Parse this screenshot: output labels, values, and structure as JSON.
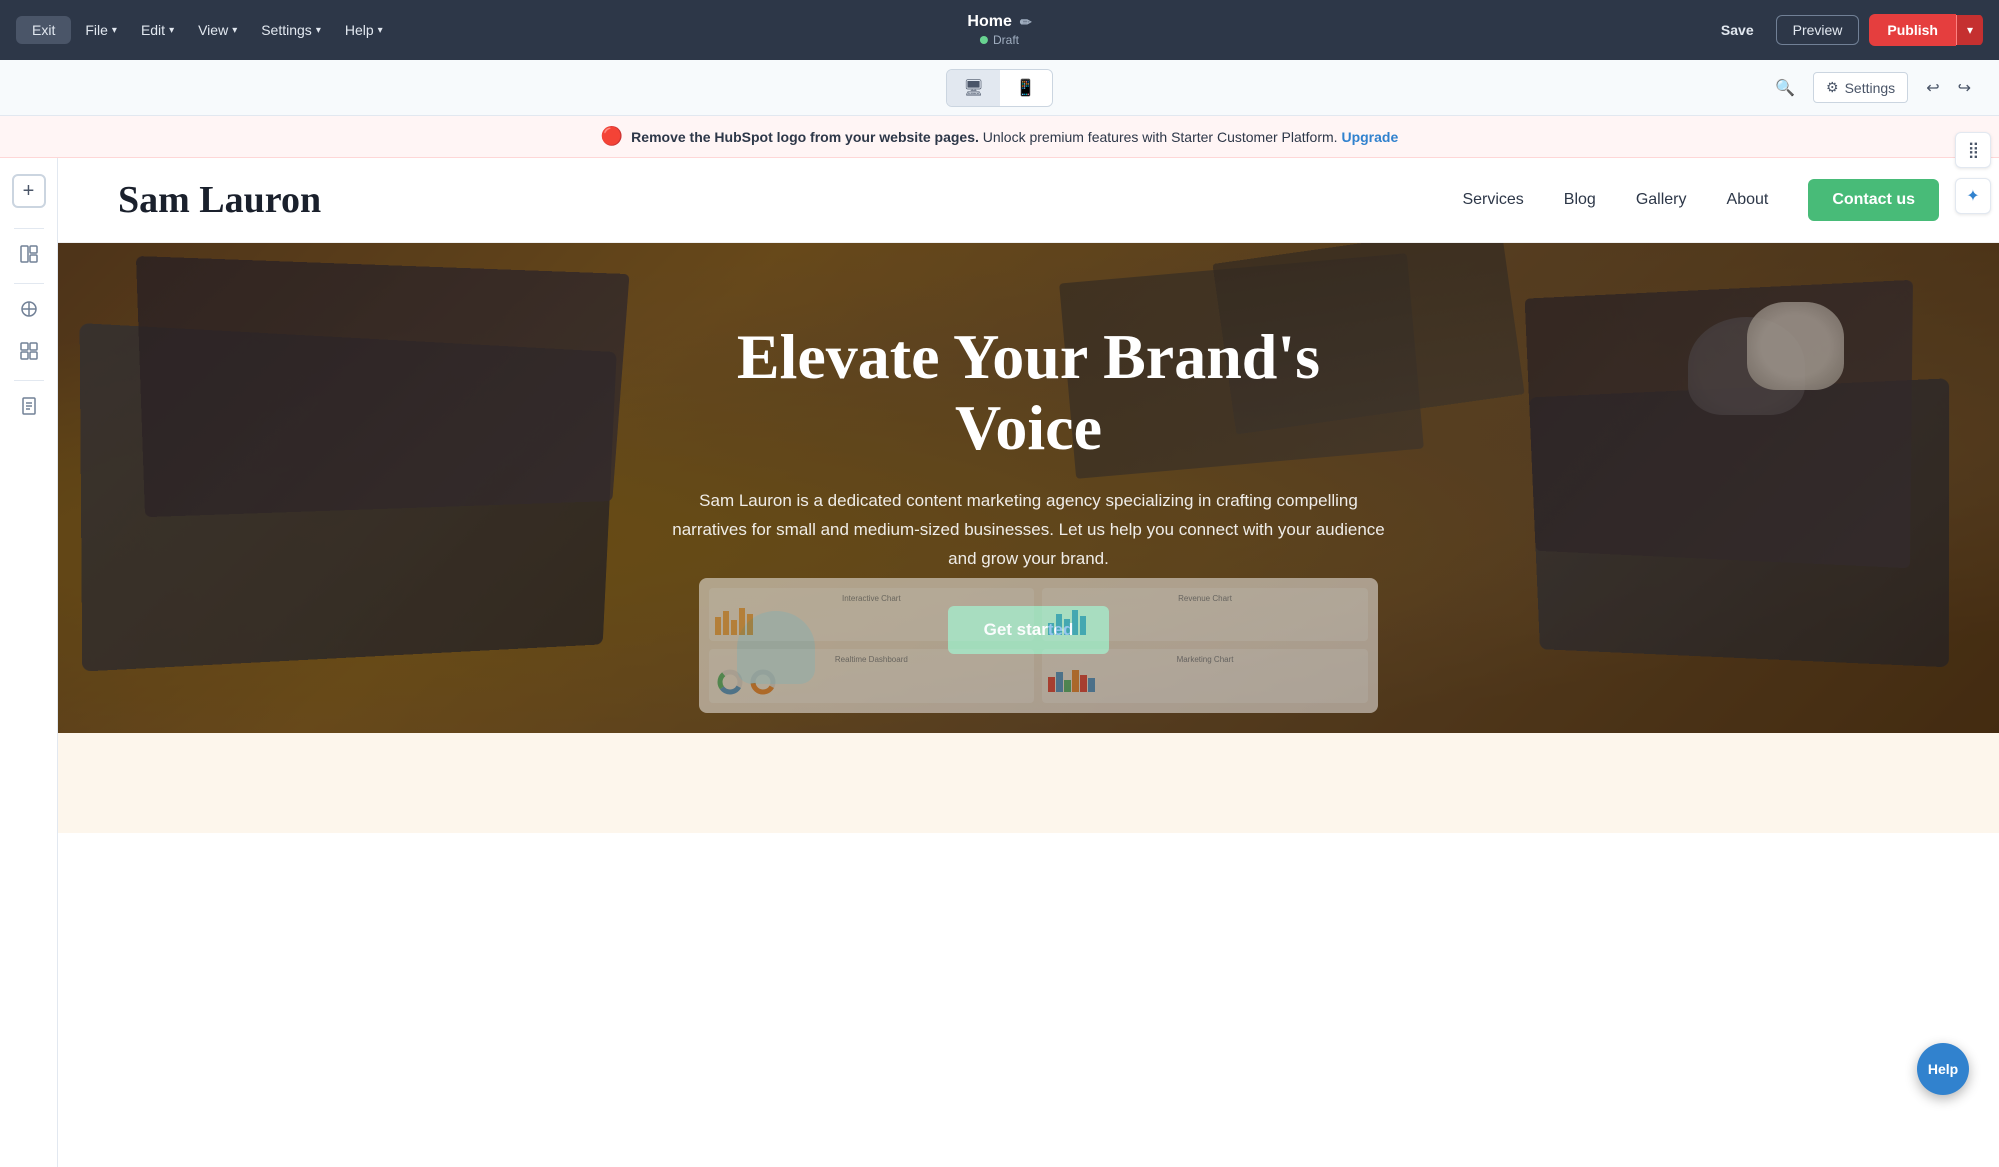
{
  "topbar": {
    "exit_label": "Exit",
    "file_label": "File",
    "edit_label": "Edit",
    "view_label": "View",
    "settings_label": "Settings",
    "help_label": "Help",
    "page_title": "Home",
    "page_status": "Draft",
    "save_label": "Save",
    "preview_label": "Preview",
    "publish_label": "Publish"
  },
  "secondary_bar": {
    "desktop_icon": "🖥",
    "mobile_icon": "📱",
    "search_icon": "🔍",
    "settings_label": "Settings",
    "gear_icon": "⚙",
    "undo_icon": "↩",
    "redo_icon": "↪"
  },
  "notification": {
    "bold_text": "Remove the HubSpot logo from your website pages.",
    "normal_text": " Unlock premium features with Starter Customer Platform.",
    "link_text": "Upgrade"
  },
  "sidebar": {
    "add_icon": "+",
    "layout_icon": "⊞",
    "design_icon": "◈",
    "components_icon": "⊟",
    "pages_icon": "⊡"
  },
  "website": {
    "logo": "Sam Lauron",
    "nav": {
      "services": "Services",
      "blog": "Blog",
      "gallery": "Gallery",
      "about": "About",
      "contact": "Contact us"
    },
    "hero": {
      "title": "Elevate Your Brand's Voice",
      "description": "Sam Lauron is a dedicated content marketing agency specializing in crafting compelling narratives for small and medium-sized businesses. Let us help you connect with your audience and grow your brand.",
      "cta": "Get started"
    }
  },
  "help_button": "Help",
  "right_panel": {
    "grid_icon": "⣿",
    "star_icon": "✦"
  }
}
